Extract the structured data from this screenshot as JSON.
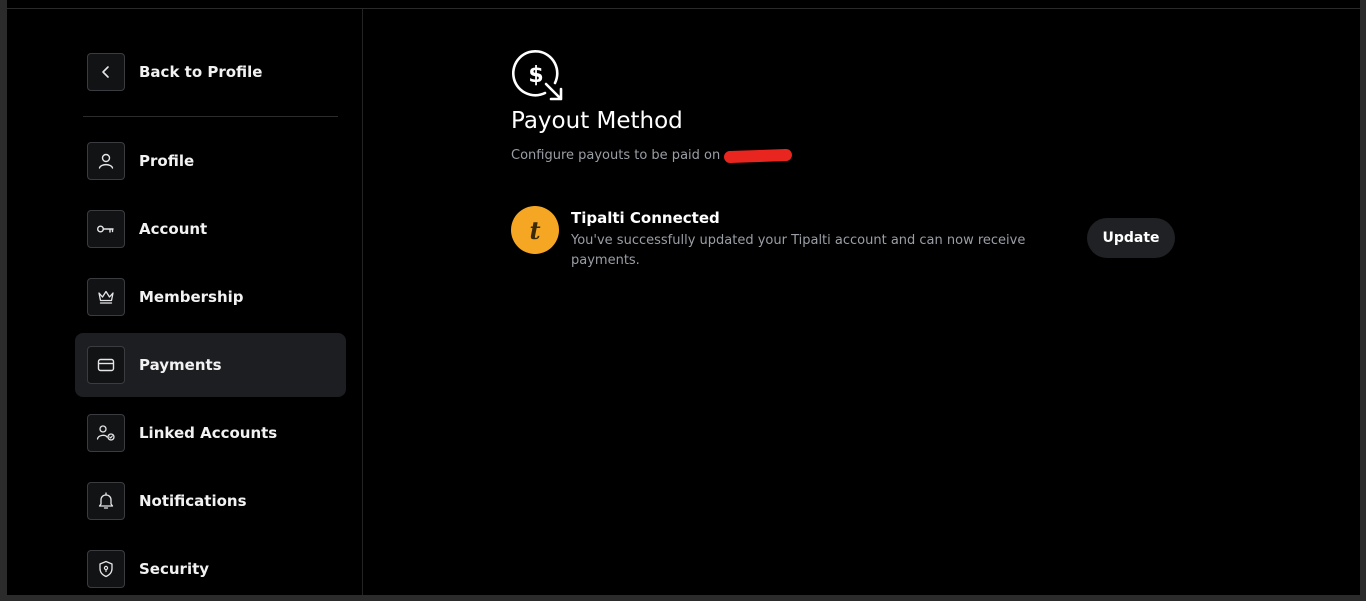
{
  "sidebar": {
    "back_label": "Back to Profile",
    "items": [
      {
        "label": "Profile",
        "icon": "user-icon"
      },
      {
        "label": "Account",
        "icon": "key-icon"
      },
      {
        "label": "Membership",
        "icon": "crown-icon"
      },
      {
        "label": "Payments",
        "icon": "card-icon",
        "active": true
      },
      {
        "label": "Linked Accounts",
        "icon": "linked-accounts-icon"
      },
      {
        "label": "Notifications",
        "icon": "bell-icon"
      },
      {
        "label": "Security",
        "icon": "shield-icon"
      }
    ]
  },
  "main": {
    "icon": "dollar-payout-icon",
    "title": "Payout Method",
    "subtitle": "Configure payouts to be paid on",
    "tipalti": {
      "logo_letter": "t",
      "title": "Tipalti Connected",
      "description": "You've successfully updated your Tipalti account and can now receive payments.",
      "update_label": "Update"
    }
  },
  "colors": {
    "background": "#000000",
    "active_item": "#1c1e21",
    "tipalti_orange": "#f5a623",
    "redaction": "#e8261f"
  }
}
